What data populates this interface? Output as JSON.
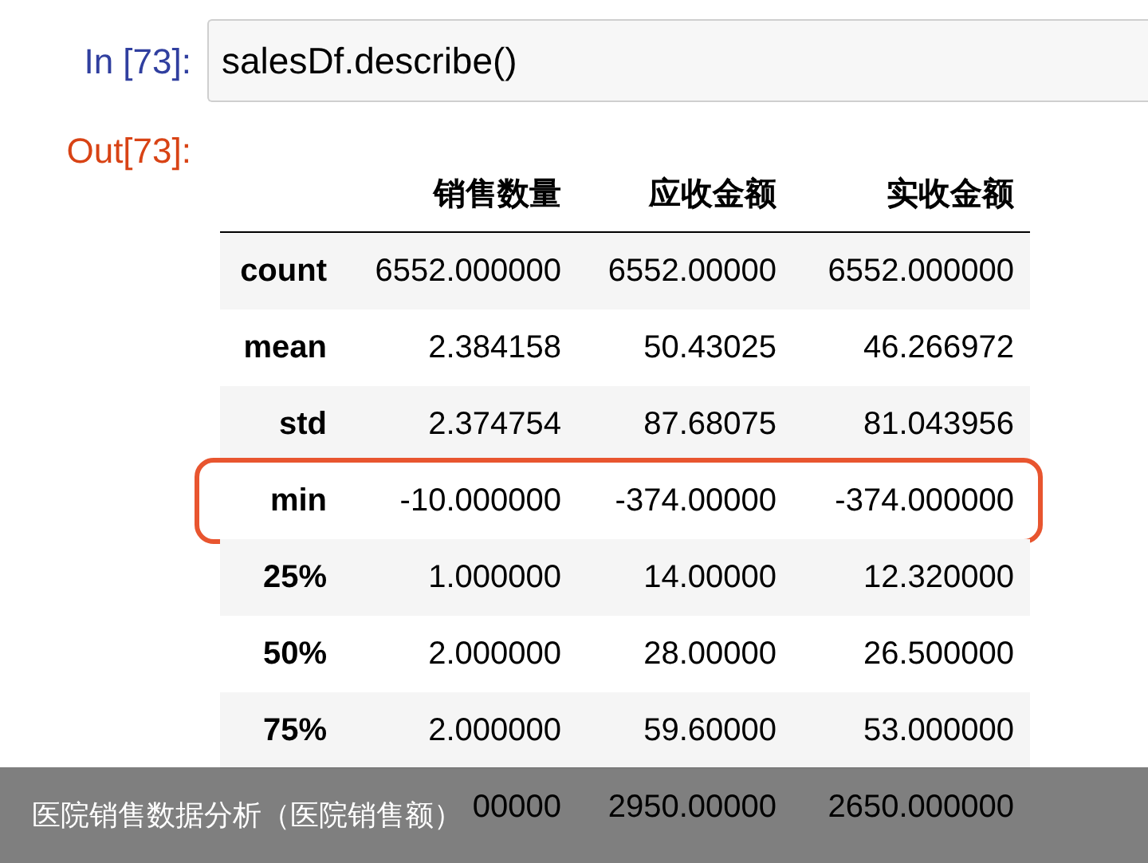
{
  "input_cell": {
    "prompt": "In [73]:",
    "code": "salesDf.describe()"
  },
  "output_cell": {
    "prompt": "Out[73]:",
    "table": {
      "columns": [
        "销售数量",
        "应收金额",
        "实收金额"
      ],
      "rows": [
        {
          "index": "count",
          "values": [
            "6552.000000",
            "6552.00000",
            "6552.000000"
          ],
          "highlighted": false
        },
        {
          "index": "mean",
          "values": [
            "2.384158",
            "50.43025",
            "46.266972"
          ],
          "highlighted": false
        },
        {
          "index": "std",
          "values": [
            "2.374754",
            "87.68075",
            "81.043956"
          ],
          "highlighted": false
        },
        {
          "index": "min",
          "values": [
            "-10.000000",
            "-374.00000",
            "-374.000000"
          ],
          "highlighted": true
        },
        {
          "index": "25%",
          "values": [
            "1.000000",
            "14.00000",
            "12.320000"
          ],
          "highlighted": false
        },
        {
          "index": "50%",
          "values": [
            "2.000000",
            "28.00000",
            "26.500000"
          ],
          "highlighted": false
        },
        {
          "index": "75%",
          "values": [
            "2.000000",
            "59.60000",
            "53.000000"
          ],
          "highlighted": false
        },
        {
          "index": "",
          "values": [
            "00000",
            "2950.00000",
            "2650.000000"
          ],
          "highlighted": false
        }
      ]
    }
  },
  "caption": "医院销售数据分析（医院销售额）"
}
